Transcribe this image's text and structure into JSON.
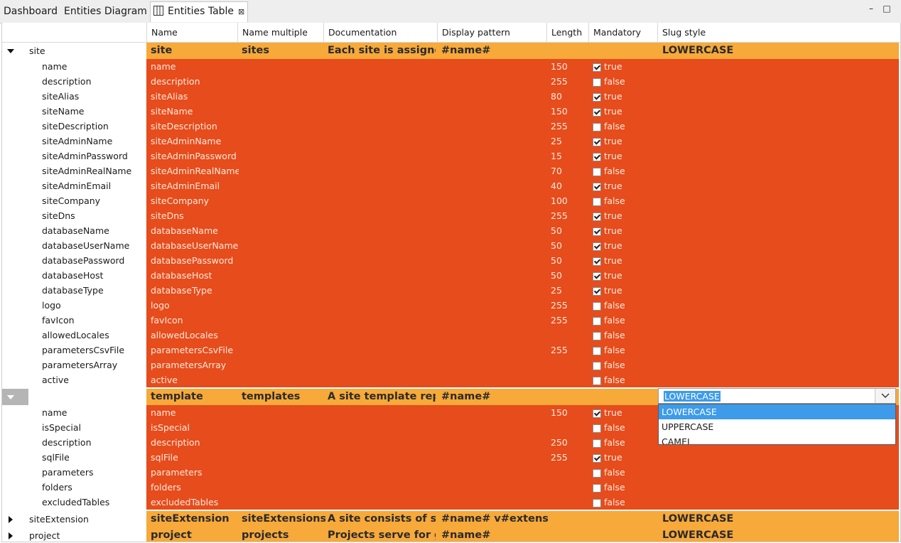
{
  "tabs": [
    {
      "label": "Dashboard"
    },
    {
      "label": "Entities Diagram"
    },
    {
      "label": "Entities Table",
      "close": "⊠"
    }
  ],
  "window_controls": {
    "minimize": "–",
    "maximize": "□"
  },
  "columns": [
    "Name",
    "Name multiple",
    "Documentation",
    "Display pattern",
    "Length",
    "Mandatory",
    "Slug style"
  ],
  "colors": {
    "entity_row": "#f7a93a",
    "attribute_row": "#e64c1c",
    "selection": "#3d9be9"
  },
  "entities": [
    {
      "tree": "site",
      "expanded": true,
      "name": "site",
      "name_multiple": "sites",
      "documentation": "Each site is assigne",
      "display_pattern": "#name#",
      "slug_style": "LOWERCASE",
      "attributes": [
        {
          "tree": "name",
          "name": "name",
          "length": "150",
          "mandatory": true,
          "mandatory_text": "true"
        },
        {
          "tree": "description",
          "name": "description",
          "length": "255",
          "mandatory": false,
          "mandatory_text": "false"
        },
        {
          "tree": "siteAlias",
          "name": "siteAlias",
          "length": "80",
          "mandatory": true,
          "mandatory_text": "true"
        },
        {
          "tree": "siteName",
          "name": "siteName",
          "length": "150",
          "mandatory": true,
          "mandatory_text": "true"
        },
        {
          "tree": "siteDescription",
          "name": "siteDescription",
          "length": "255",
          "mandatory": false,
          "mandatory_text": "false"
        },
        {
          "tree": "siteAdminName",
          "name": "siteAdminName",
          "length": "25",
          "mandatory": true,
          "mandatory_text": "true"
        },
        {
          "tree": "siteAdminPassword",
          "name": "siteAdminPassword",
          "length": "15",
          "mandatory": true,
          "mandatory_text": "true"
        },
        {
          "tree": "siteAdminRealName",
          "name": "siteAdminRealName",
          "length": "70",
          "mandatory": false,
          "mandatory_text": "false"
        },
        {
          "tree": "siteAdminEmail",
          "name": "siteAdminEmail",
          "length": "40",
          "mandatory": true,
          "mandatory_text": "true"
        },
        {
          "tree": "siteCompany",
          "name": "siteCompany",
          "length": "100",
          "mandatory": false,
          "mandatory_text": "false"
        },
        {
          "tree": "siteDns",
          "name": "siteDns",
          "length": "255",
          "mandatory": true,
          "mandatory_text": "true"
        },
        {
          "tree": "databaseName",
          "name": "databaseName",
          "length": "50",
          "mandatory": true,
          "mandatory_text": "true"
        },
        {
          "tree": "databaseUserName",
          "name": "databaseUserName",
          "length": "50",
          "mandatory": true,
          "mandatory_text": "true"
        },
        {
          "tree": "databasePassword",
          "name": "databasePassword",
          "length": "50",
          "mandatory": true,
          "mandatory_text": "true"
        },
        {
          "tree": "databaseHost",
          "name": "databaseHost",
          "length": "50",
          "mandatory": true,
          "mandatory_text": "true"
        },
        {
          "tree": "databaseType",
          "name": "databaseType",
          "length": "25",
          "mandatory": true,
          "mandatory_text": "true"
        },
        {
          "tree": "logo",
          "name": "logo",
          "length": "255",
          "mandatory": false,
          "mandatory_text": "false"
        },
        {
          "tree": "favIcon",
          "name": "favIcon",
          "length": "255",
          "mandatory": false,
          "mandatory_text": "false"
        },
        {
          "tree": "allowedLocales",
          "name": "allowedLocales",
          "length": "",
          "mandatory": false,
          "mandatory_text": "false"
        },
        {
          "tree": "parametersCsvFile",
          "name": "parametersCsvFile",
          "length": "255",
          "mandatory": false,
          "mandatory_text": "false"
        },
        {
          "tree": "parametersArray",
          "name": "parametersArray",
          "length": "",
          "mandatory": false,
          "mandatory_text": "false"
        },
        {
          "tree": "active",
          "name": "active",
          "length": "",
          "mandatory": false,
          "mandatory_text": "false"
        }
      ]
    },
    {
      "tree": "",
      "expanded": true,
      "selected": true,
      "name": "template",
      "name_multiple": "templates",
      "documentation": "A site template repre",
      "display_pattern": "#name#",
      "slug_style": "LOWERCASE",
      "attributes": [
        {
          "tree": "name",
          "name": "name",
          "length": "150",
          "mandatory": true,
          "mandatory_text": "true"
        },
        {
          "tree": "isSpecial",
          "name": "isSpecial",
          "length": "",
          "mandatory": false,
          "mandatory_text": "false"
        },
        {
          "tree": "description",
          "name": "description",
          "length": "250",
          "mandatory": false,
          "mandatory_text": "false"
        },
        {
          "tree": "sqlFile",
          "name": "sqlFile",
          "length": "255",
          "mandatory": true,
          "mandatory_text": "true"
        },
        {
          "tree": "parameters",
          "name": "parameters",
          "length": "",
          "mandatory": false,
          "mandatory_text": "false"
        },
        {
          "tree": "folders",
          "name": "folders",
          "length": "",
          "mandatory": false,
          "mandatory_text": "false"
        },
        {
          "tree": "excludedTables",
          "name": "excludedTables",
          "length": "",
          "mandatory": false,
          "mandatory_text": "false"
        }
      ]
    },
    {
      "tree": "siteExtension",
      "expanded": false,
      "name": "siteExtension",
      "name_multiple": "siteExtensions",
      "documentation": "A site consists of se",
      "display_pattern": "#name# v#extensio",
      "slug_style": "LOWERCASE",
      "attributes": []
    },
    {
      "tree": "project",
      "expanded": false,
      "name": "project",
      "name_multiple": "projects",
      "documentation": "Projects serve for gı",
      "display_pattern": "#name#",
      "slug_style": "LOWERCASE",
      "attributes": []
    }
  ],
  "slug_editor": {
    "value": "LOWERCASE",
    "options": [
      "LOWERCASE",
      "UPPERCASE",
      "CAMEL"
    ],
    "highlighted": 0
  }
}
